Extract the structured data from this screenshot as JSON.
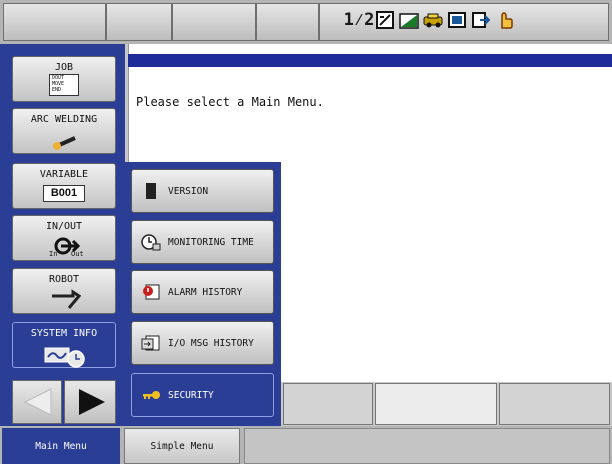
{
  "status_icons": [
    "one-two-arrows-icon",
    "edit-box-icon",
    "level-chart-icon",
    "car-ok-icon",
    "teach-box-icon",
    "exit-icon",
    "hand-pointer-icon"
  ],
  "status_text": {
    "one_two": "1⁄2"
  },
  "main_menu": [
    {
      "label": "JOB",
      "icon": "job-doc-icon",
      "icon_text": [
        "DOUT",
        "MOVE",
        "END"
      ]
    },
    {
      "label": "ARC WELDING",
      "icon": "welding-torch-icon"
    },
    {
      "label": "VARIABLE",
      "icon": "variable-box-icon",
      "icon_text": "B001"
    },
    {
      "label": "IN/OUT",
      "icon": "in-out-icon",
      "icon_text_in": "In",
      "icon_text_out": "Out"
    },
    {
      "label": "ROBOT",
      "icon": "robot-arm-icon"
    },
    {
      "label": "SYSTEM INFO",
      "icon": "system-info-icon",
      "active": true
    }
  ],
  "message": "Please select a Main Menu.",
  "submenu": [
    {
      "label": "VERSION",
      "icon": "version-icon"
    },
    {
      "label": "MONITORING TIME",
      "icon": "monitoring-time-icon"
    },
    {
      "label": "ALARM HISTORY",
      "icon": "alarm-history-icon"
    },
    {
      "label": "I/O MSG HISTORY",
      "icon": "io-msg-history-icon"
    },
    {
      "label": "SECURITY",
      "icon": "security-key-icon",
      "active": true
    }
  ],
  "footer": {
    "main_menu": "Main Menu",
    "simple_menu": "Simple Menu"
  },
  "colors": {
    "panel_blue": "#2b3e96",
    "content_bar": "#1e2c9a",
    "button_grey": "#d8d8d8"
  }
}
